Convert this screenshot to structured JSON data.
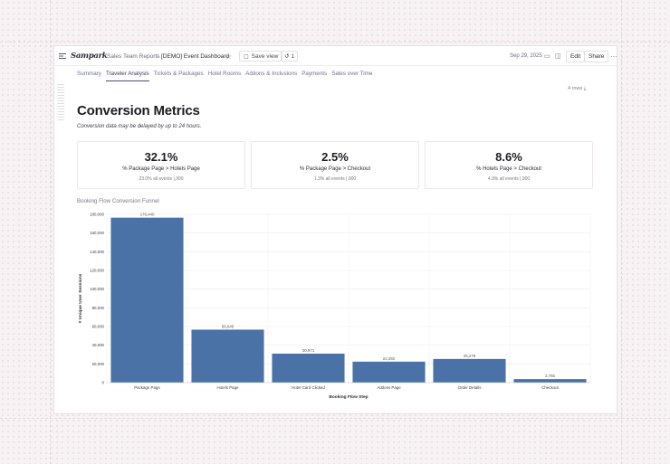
{
  "topbar": {
    "logo": "Sampark",
    "breadcrumb_parent": "Sales Team Reports",
    "breadcrumb_sep": "/",
    "breadcrumb_current": "[DEMO] Event Dashboard",
    "save_view_label": "Save view",
    "version_count": "1",
    "date": "Sep 29, 2025",
    "edit_label": "Edit",
    "share_label": "Share",
    "icons": {
      "sidebar": "sidebar-toggle-icon",
      "star": "star-icon",
      "save": "save-icon",
      "version": "history-icon",
      "comment": "comment-icon",
      "panel": "panel-icon",
      "more": "more-icon"
    }
  },
  "tabs": [
    {
      "label": "Summary",
      "active": false
    },
    {
      "label": "Traveler Analysis",
      "active": true
    },
    {
      "label": "Tickets & Packages",
      "active": false
    },
    {
      "label": "Hotel Rooms",
      "active": false
    },
    {
      "label": "Addons & Inclusions",
      "active": false
    },
    {
      "label": "Payments",
      "active": false
    },
    {
      "label": "Sales over Time",
      "active": false
    }
  ],
  "rows_count": "4 rows",
  "page_title": "Conversion Metrics",
  "page_subtitle": "Conversion data may be delayed by up to 24 hours.",
  "metrics": [
    {
      "value": "32.1%",
      "label": "% Package Page > Hotels Page",
      "sub": "23.0% all events |,900"
    },
    {
      "value": "2.5%",
      "label": "% Package Page > Checkout",
      "sub": "1.3% all events |,900"
    },
    {
      "value": "8.6%",
      "label": "% Hotels Page > Checkout",
      "sub": "4.9% all events |,900"
    }
  ],
  "chart_title": "Booking Flow Conversion Funnel",
  "chart_data": {
    "type": "bar",
    "categories": [
      "Package Page",
      "Hotels Page",
      "Hotel Card Clicked",
      "Addons Page",
      "Order Details",
      "Checkout"
    ],
    "values": [
      176440,
      56645,
      30971,
      22392,
      25279,
      3766
    ],
    "data_labels": [
      "176,440",
      "56,645",
      "30,971",
      "22,392",
      "25,279",
      "3,766"
    ],
    "xlabel": "Booking Flow Step",
    "ylabel": "# Unique User Sessions",
    "ylim": [
      0,
      180000
    ],
    "yticks": [
      0,
      20000,
      40000,
      60000,
      80000,
      100000,
      120000,
      140000,
      160000,
      180000
    ],
    "ytick_labels": [
      "0",
      "20,000",
      "40,000",
      "60,000",
      "80,000",
      "100,000",
      "120,000",
      "140,000",
      "160,000",
      "180,000"
    ],
    "grid": true,
    "bar_color": "#4a72a6"
  }
}
